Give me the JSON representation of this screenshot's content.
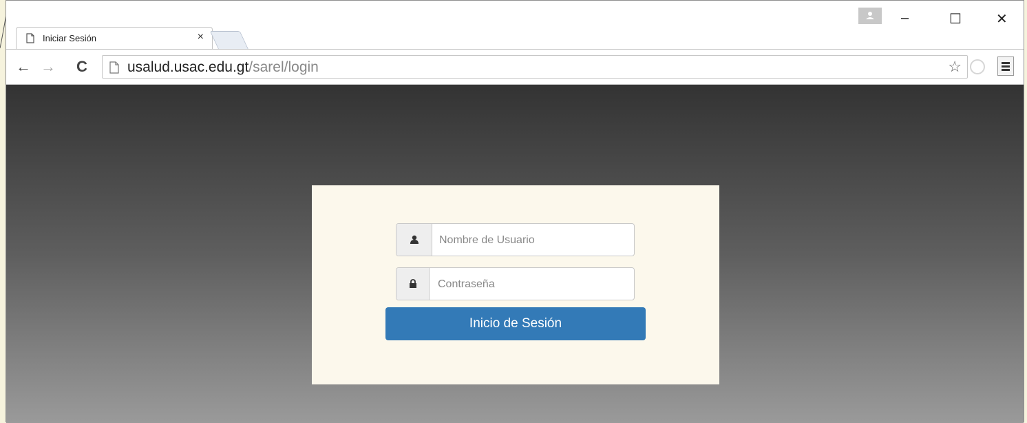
{
  "browser": {
    "tab_title": "Iniciar Sesión",
    "tab_close": "×",
    "url_host": "usalud.usac.edu.gt",
    "url_path": "/sarel/login",
    "window_controls": {
      "minimize": "–",
      "maximize": "☐",
      "close": "✕"
    },
    "nav": {
      "back": "←",
      "forward": "→",
      "reload": "C"
    },
    "bookmark_star": "☆"
  },
  "login": {
    "username_placeholder": "Nombre de Usuario",
    "username_value": "",
    "password_placeholder": "Contraseña",
    "password_value": "",
    "submit_label": "Inicio de Sesión"
  },
  "colors": {
    "card_bg": "#fcf8ec",
    "button_bg": "#337ab7",
    "content_gradient_top": "#333333",
    "content_gradient_bottom": "#9a9a9a"
  },
  "icons": {
    "username": "user-icon",
    "password": "lock-icon",
    "tab": "document-icon",
    "address": "page-icon",
    "profile": "profile-avatar-icon",
    "cast": "cast-icon",
    "menu": "menu-icon"
  }
}
